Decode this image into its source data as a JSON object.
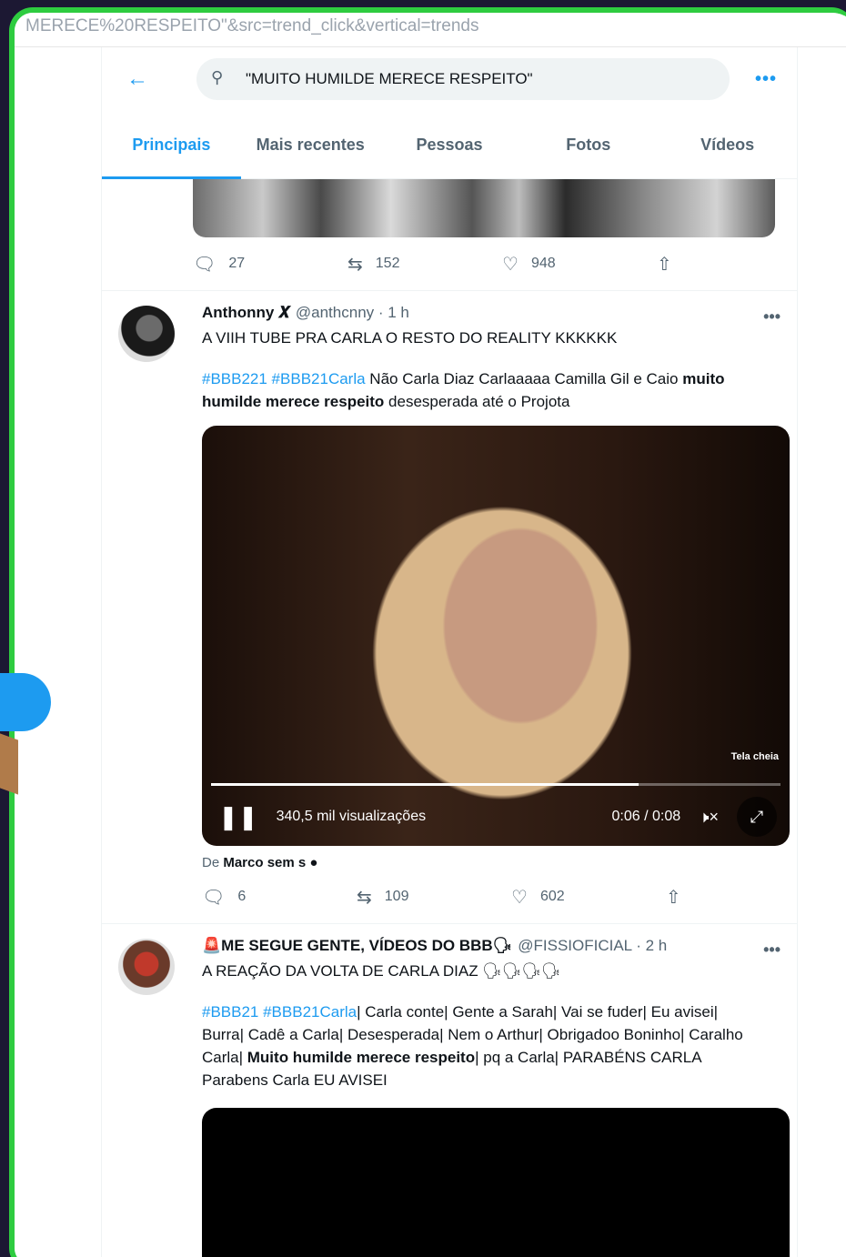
{
  "browser": {
    "url_fragment": "MERECE%20RESPEITO\"&src=trend_click&vertical=trends"
  },
  "search": {
    "query": "\"MUITO HUMILDE MERECE RESPEITO\"",
    "more": "•••"
  },
  "tabs": [
    {
      "label": "Principais"
    },
    {
      "label": "Mais recentes"
    },
    {
      "label": "Pessoas"
    },
    {
      "label": "Fotos"
    },
    {
      "label": "Vídeos"
    }
  ],
  "tweet0": {
    "replies": "27",
    "retweets": "152",
    "likes": "948"
  },
  "tweet1": {
    "name": "Anthonny 𝑿",
    "handle": "@anthcnny · 1 h",
    "text": "A VIIH TUBE PRA CARLA O RESTO DO REALITY KKKKKK",
    "hashtags": "#BBB221 #BBB21Carla",
    "body": " Não Carla Diaz Carlaaaaa Camilla Gil e Caio ",
    "bold": "muito humilde merece respeito",
    "tail": " desesperada até o Projota",
    "video": {
      "label": "Tela cheia",
      "views": "340,5 mil visualizações",
      "time": "0:06 / 0:08",
      "progress": 0.75
    },
    "from_prefix": "De ",
    "from_name": "Marco sem s ●",
    "replies": "6",
    "retweets": "109",
    "likes": "602"
  },
  "tweet2": {
    "name": "🚨ME SEGUE GENTE, VÍDEOS DO BBB🗣",
    "handle": "@FISSIOFICIAL · 2 h",
    "text": "A REAÇÃO DA VOLTA DE CARLA DIAZ 🗣🗣🗣🗣",
    "hashtags": "#BBB21 #BBB21Carla",
    "body": "| Carla conte| Gente a Sarah| Vai se fuder| Eu avisei| Burra| Cadê a Carla| Desesperada| Nem o Arthur| Obrigadoo Boninho| Caralho Carla| ",
    "bold": "Muito humilde merece respeito",
    "tail": "| pq a Carla| PARABÉNS CARLA Parabens Carla EU AVISEI"
  },
  "misc": {
    "dots": "•••"
  }
}
